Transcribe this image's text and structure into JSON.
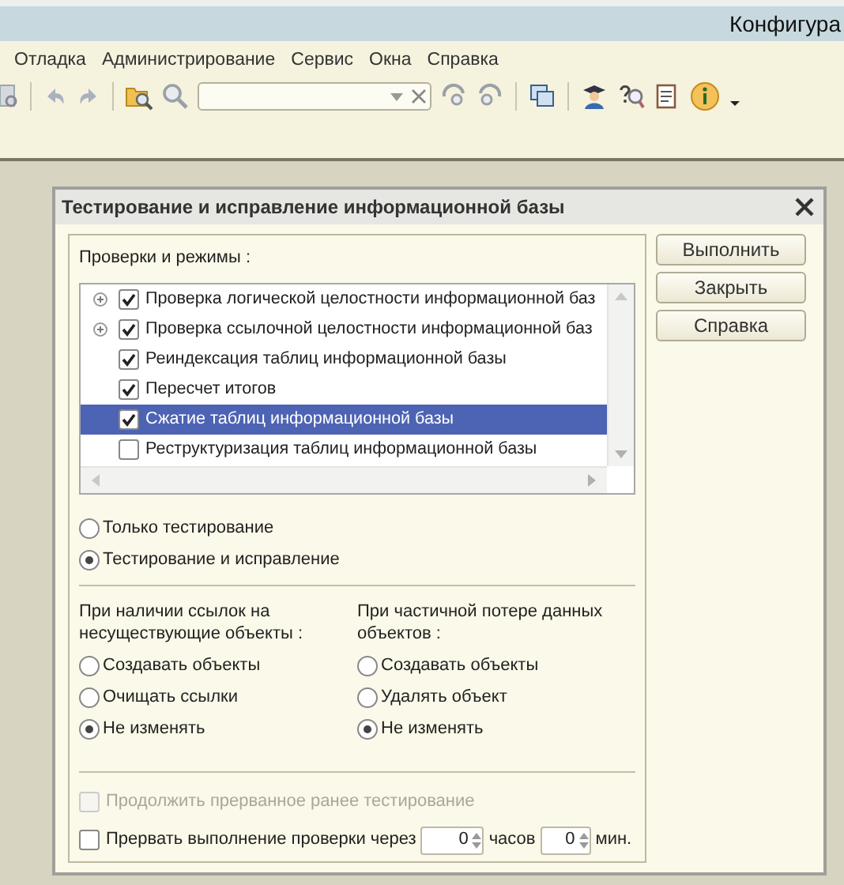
{
  "app": {
    "title": "Конфигура"
  },
  "menu": [
    {
      "label": "Отладка"
    },
    {
      "label": "Администрирование"
    },
    {
      "label": "Сервис"
    },
    {
      "label": "Окна"
    },
    {
      "label": "Справка"
    }
  ],
  "dialog": {
    "title": "Тестирование и исправление информационной базы",
    "checks_label": "Проверки и режимы :",
    "checks": [
      {
        "label": "Проверка логической целостности информационной баз",
        "checked": true,
        "expandable": true,
        "selected": false
      },
      {
        "label": "Проверка ссылочной целостности информационной баз",
        "checked": true,
        "expandable": true,
        "selected": false
      },
      {
        "label": "Реиндексация таблиц информационной базы",
        "checked": true,
        "expandable": false,
        "selected": false
      },
      {
        "label": "Пересчет итогов",
        "checked": true,
        "expandable": false,
        "selected": false
      },
      {
        "label": "Сжатие таблиц информационной базы",
        "checked": true,
        "expandable": false,
        "selected": true
      },
      {
        "label": "Реструктуризация таблиц информационной базы",
        "checked": false,
        "expandable": false,
        "selected": false
      }
    ],
    "modes": [
      {
        "label": "Только тестирование",
        "selected": false
      },
      {
        "label": "Тестирование и исправление",
        "selected": true
      }
    ],
    "option_groups": [
      {
        "label": "При наличии ссылок на несуществующие объекты :",
        "options": [
          {
            "label": "Создавать объекты",
            "selected": false
          },
          {
            "label": "Очищать ссылки",
            "selected": false
          },
          {
            "label": "Не изменять",
            "selected": true
          }
        ]
      },
      {
        "label": "При частичной потере данных объектов :",
        "options": [
          {
            "label": "Создавать объекты",
            "selected": false
          },
          {
            "label": "Удалять объект",
            "selected": false
          },
          {
            "label": "Не изменять",
            "selected": true
          }
        ]
      }
    ],
    "continue": {
      "label": "Продолжить прерванное ранее тестирование",
      "checked": false,
      "disabled": true
    },
    "interrupt": {
      "label": "Прервать выполнение проверки через",
      "checked": false,
      "disabled": false,
      "hours": "0",
      "hours_unit": "часов",
      "minutes": "0",
      "minutes_unit": "мин."
    },
    "buttons": [
      {
        "label": "Выполнить"
      },
      {
        "label": "Закрыть"
      },
      {
        "label": "Справка"
      }
    ]
  }
}
